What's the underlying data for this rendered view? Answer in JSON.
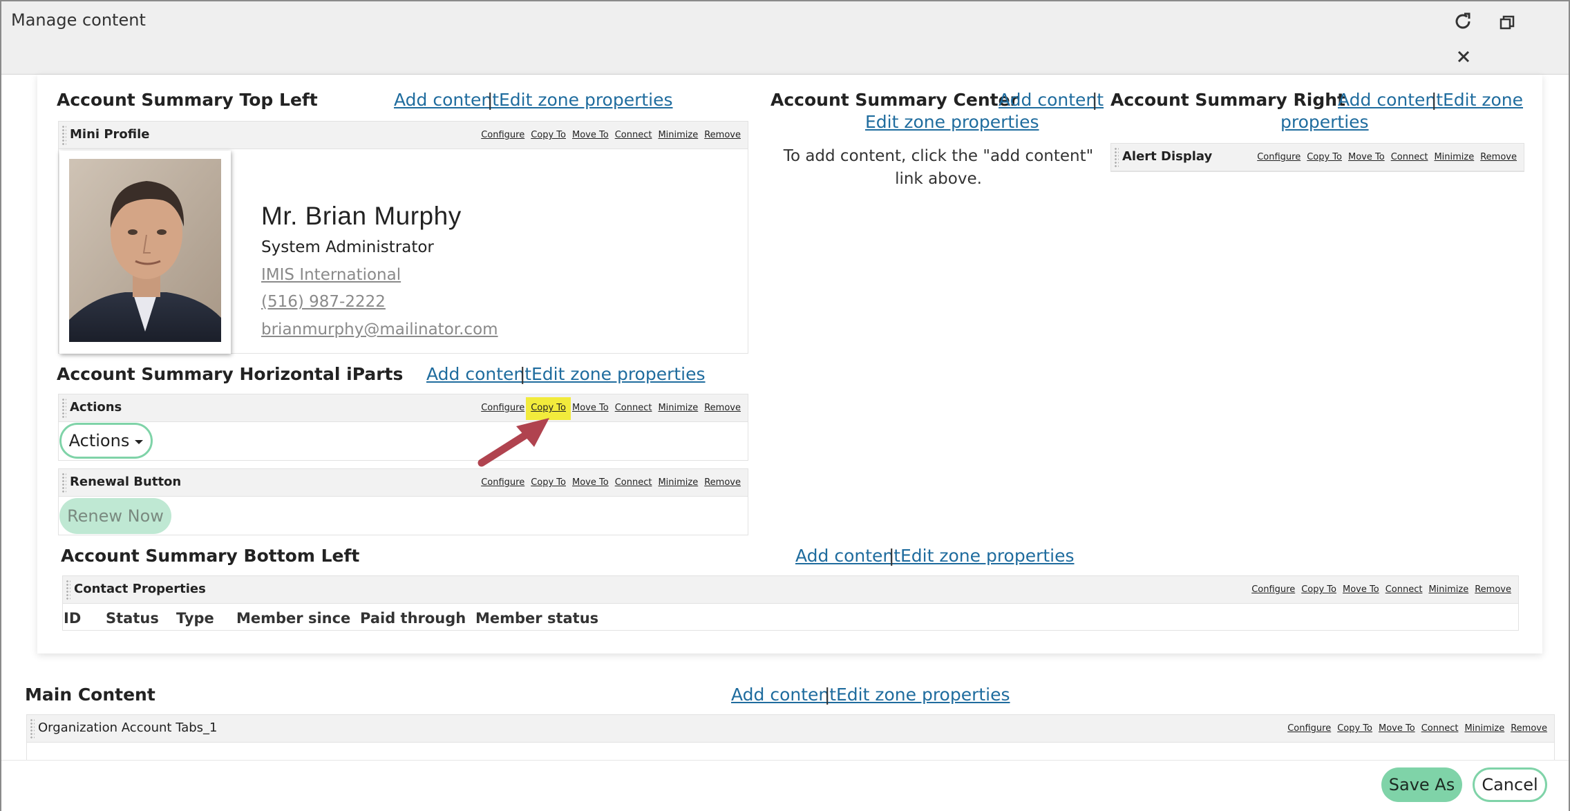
{
  "window": {
    "title": "Manage content",
    "icons": [
      "refresh-icon",
      "restore-window-icon",
      "close-icon"
    ]
  },
  "links": {
    "add_content": "Add content",
    "edit_zone_properties": "Edit zone properties",
    "edit_zone": "Edit zone",
    "properties": "properties",
    "separator": "|"
  },
  "ipart_actions": [
    "Configure",
    "Copy To",
    "Move To",
    "Connect",
    "Minimize",
    "Remove"
  ],
  "zones": {
    "top_left": {
      "title": "Account Summary Top Left"
    },
    "center": {
      "title": "Account Summary Center",
      "empty_message": "To add content, click the \"add content\" link above."
    },
    "right": {
      "title": "Account Summary Right"
    },
    "horizontal": {
      "title": "Account Summary Horizontal iParts"
    },
    "bottom_left": {
      "title": "Account Summary Bottom Left"
    },
    "main": {
      "title": "Main Content"
    }
  },
  "iparts": {
    "mini_profile": "Mini Profile",
    "alert_display": "Alert Display",
    "actions": "Actions",
    "renewal_button": "Renewal Button",
    "contact_properties": "Contact Properties",
    "org_tabs": "Organization Account Tabs_1"
  },
  "profile": {
    "name": "Mr. Brian Murphy",
    "role": "System Administrator",
    "company": "IMIS International",
    "phone": "(516) 987-2222",
    "email": "brianmurphy@mailinator.com"
  },
  "actions_dropdown": {
    "label": "Actions"
  },
  "renew_button": {
    "label": "Renew Now"
  },
  "contact_table": {
    "columns": [
      "ID",
      "Status",
      "Type",
      "Member since",
      "Paid through",
      "Member status"
    ]
  },
  "footer": {
    "save_as": "Save As",
    "cancel": "Cancel"
  },
  "colors": {
    "link": "#1f6c9e",
    "accent_green": "#7fd3a8",
    "highlight": "#f2eb3c",
    "arrow": "#b0434f"
  }
}
